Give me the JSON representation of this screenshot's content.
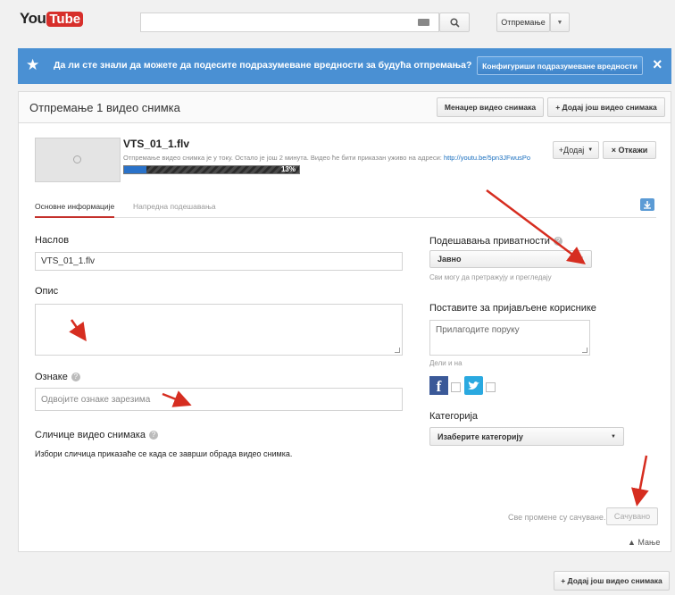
{
  "header": {
    "logo_you": "You",
    "logo_tube": "Tube",
    "upload_label": "Отпремање",
    "upload_arrow": "▼"
  },
  "banner": {
    "text": "Да ли сте знали да можете да подесите подразумеване вредности за будућа отпремања?",
    "button": "Конфигуриши подразумеване вредности",
    "close": "×"
  },
  "upload_header": {
    "title": "Отпремање 1 видео снимка",
    "video_manager": "Менаџер видео снимака",
    "add_more": "+ Додај још видео снимака"
  },
  "video": {
    "title": "VTS_01_1.flv",
    "status_text": "Отпремање видео снимка је у току. Остало је још 2 минута. Видео ће бити приказан уживо на адреси:",
    "url": "http://youtu.be/5pn3JFwusPo",
    "progress_label": "13%",
    "progress": 0.13,
    "add_button": "+Додај",
    "cancel_button": "× Откажи"
  },
  "tabs": [
    {
      "label": "Основне информације"
    },
    {
      "label": "Напредна подешавања"
    }
  ],
  "form": {
    "title_label": "Наслов",
    "title_value": "VTS_01_1.flv",
    "description_label": "Опис",
    "tags_label": "Ознаке",
    "tags_placeholder": "Одвојите ознаке зарезима",
    "thumbnails_label": "Сличице видео снимака",
    "thumbnails_text": "Избори сличица приказаће се када се заврши обрада видео снимка."
  },
  "privacy": {
    "label": "Подешавања приватности",
    "selected": "Јавно",
    "note": "Сви могу да претражују и прегледају"
  },
  "share": {
    "label": "Поставите за пријављене кориснике",
    "placeholder": "Прилагодите поруку",
    "note": "Дели и на"
  },
  "category": {
    "label": "Категорија",
    "selected": "Изаберите категорију"
  },
  "footer": {
    "saved_status": "Све промене су сачуване.",
    "saved_button": "Сачувано",
    "less": "▲ Мање",
    "add_more": "+ Додај још видео снимака"
  },
  "colors": {
    "banner": "#4a90d3",
    "progress": "#2a72c9",
    "link": "#1a6fbf",
    "youtube_red": "#d72f2b",
    "arrow": "#d62d20",
    "facebook": "#3b5998",
    "twitter": "#2aa9e0"
  }
}
